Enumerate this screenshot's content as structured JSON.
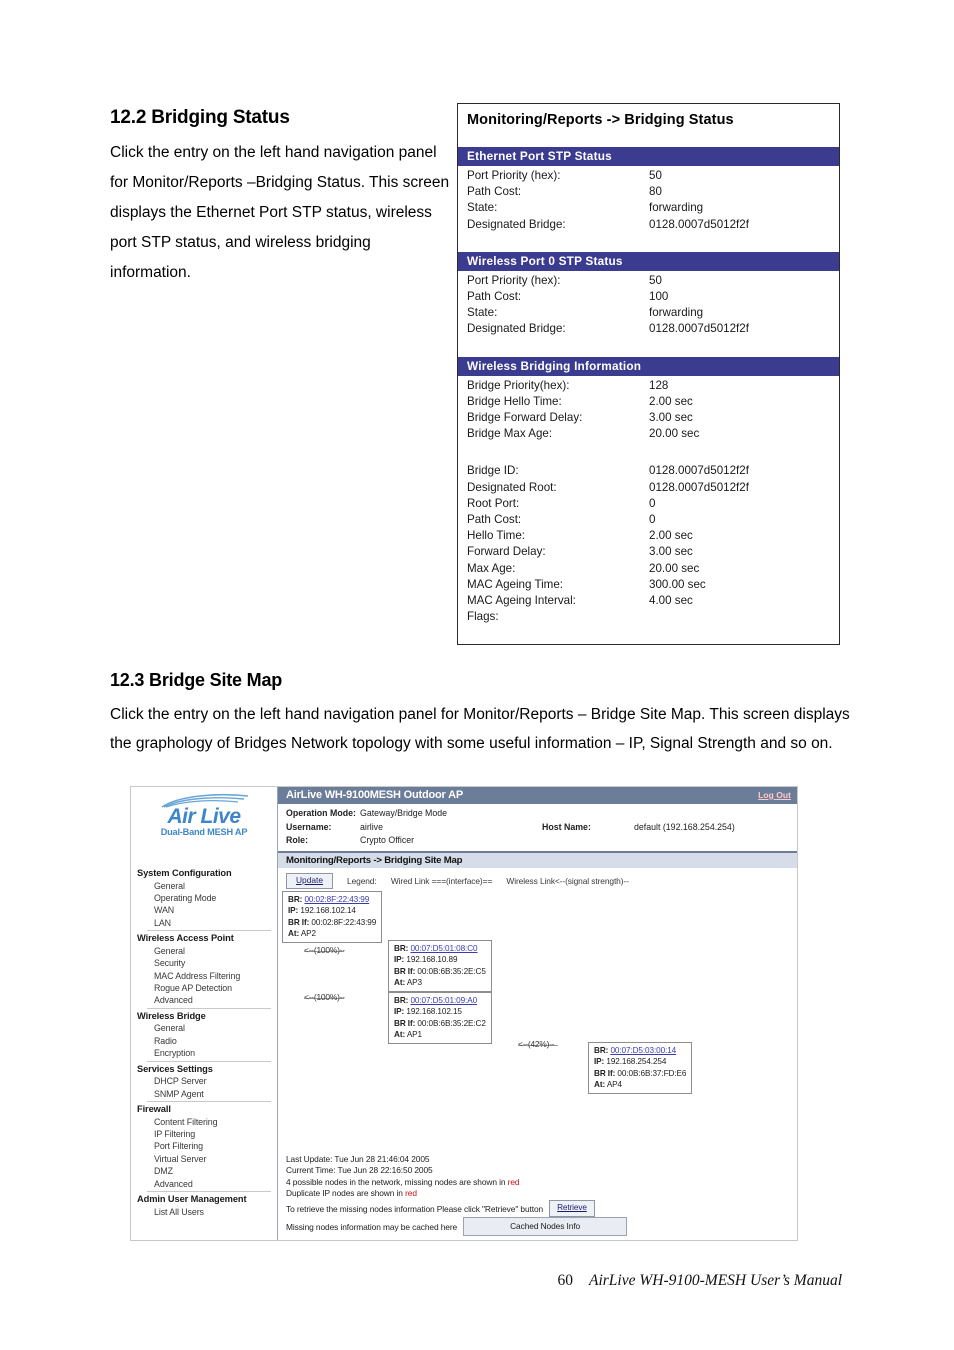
{
  "section_122": {
    "title": "12.2 Bridging Status",
    "body": "Click the entry on the left hand navigation panel for Monitor/Reports –Bridging Status. This screen displays the Ethernet Port STP status, wireless port STP status, and wireless bridging information."
  },
  "section_123": {
    "title": "12.3 Bridge Site Map",
    "body": "Click the entry on the left hand navigation panel for Monitor/Reports – Bridge Site Map. This screen displays the graphology of Bridges Network topology with some useful information – IP, Signal Strength and so on."
  },
  "bridging_status": {
    "page_title": "Monitoring/Reports -> Bridging Status",
    "sections": [
      {
        "heading": "Ethernet Port STP Status",
        "rows": [
          {
            "key": "Port Priority (hex):",
            "value": "50"
          },
          {
            "key": "Path Cost:",
            "value": "80"
          },
          {
            "key": "State:",
            "value": "forwarding"
          },
          {
            "key": "Designated Bridge:",
            "value": "0128.0007d5012f2f"
          }
        ]
      },
      {
        "heading": "Wireless Port 0 STP Status",
        "rows": [
          {
            "key": "Port Priority (hex):",
            "value": "50"
          },
          {
            "key": "Path Cost:",
            "value": "100"
          },
          {
            "key": "State:",
            "value": "forwarding"
          },
          {
            "key": "Designated Bridge:",
            "value": "0128.0007d5012f2f"
          }
        ]
      },
      {
        "heading": "Wireless Bridging Information",
        "rows": [
          {
            "key": "Bridge Priority(hex):",
            "value": "128"
          },
          {
            "key": "Bridge Hello Time:",
            "value": "2.00 sec"
          },
          {
            "key": "Bridge Forward Delay:",
            "value": "3.00 sec"
          },
          {
            "key": "Bridge Max Age:",
            "value": "20.00 sec"
          }
        ],
        "rows2": [
          {
            "key": "Bridge ID:",
            "value": "0128.0007d5012f2f"
          },
          {
            "key": "Designated Root:",
            "value": "0128.0007d5012f2f"
          },
          {
            "key": "Root Port:",
            "value": "0"
          },
          {
            "key": "Path Cost:",
            "value": "0"
          },
          {
            "key": "Hello Time:",
            "value": "2.00 sec"
          },
          {
            "key": "Forward Delay:",
            "value": "3.00 sec"
          },
          {
            "key": "Max Age:",
            "value": "20.00 sec"
          },
          {
            "key": "MAC Ageing Time:",
            "value": "300.00 sec"
          },
          {
            "key": "MAC Ageing Interval:",
            "value": "4.00 sec"
          },
          {
            "key": "Flags:",
            "value": ""
          }
        ]
      }
    ]
  },
  "site_map": {
    "logo": {
      "brand": "Air Live",
      "tagline": "Dual-Band MESH AP"
    },
    "titlebar": {
      "title": "AirLive WH-9100MESH Outdoor AP",
      "logout": "Log Out"
    },
    "info": {
      "operation_mode_label": "Operation Mode:",
      "operation_mode_value": "Gateway/Bridge Mode",
      "username_label": "Username:",
      "username_value": "airlive",
      "host_name_label": "Host Name:",
      "host_name_value": "default (192.168.254.254)",
      "role_label": "Role:",
      "role_value": "Crypto Officer"
    },
    "breadcrumb": "Monitoring/Reports -> Bridging Site Map",
    "toolbar": {
      "update_button": "Update",
      "legend_label": "Legend:",
      "legend_wired": "Wired Link ===(interface)==",
      "legend_wireless": "Wireless Link<--(signal strength)--"
    },
    "nav": [
      {
        "group": "System Configuration",
        "items": [
          "General",
          "Operating Mode",
          "WAN",
          "LAN"
        ]
      },
      {
        "group": "Wireless Access Point",
        "items": [
          "General",
          "Security",
          "MAC Address Filtering",
          "Rogue AP Detection",
          "Advanced"
        ]
      },
      {
        "group": "Wireless Bridge",
        "items": [
          "General",
          "Radio",
          "Encryption"
        ]
      },
      {
        "group": "Services Settings",
        "items": [
          "DHCP Server",
          "SNMP Agent"
        ]
      },
      {
        "group": "Firewall",
        "items": [
          "Content Filtering",
          "IP Filtering",
          "Port Filtering",
          "Virtual Server",
          "DMZ",
          "Advanced"
        ]
      },
      {
        "group": "Admin User Management",
        "items": [
          "List All Users"
        ]
      }
    ],
    "nodes": [
      {
        "br_label": "BR:",
        "br_mac": "00:02:8F:22:43:99",
        "ip_label": "IP:",
        "ip_value": "192.168.102.14",
        "brif_label": "BR If:",
        "brif_value": "00:02:8F:22:43:99",
        "at_label": "At:",
        "at_value": "AP2"
      },
      {
        "br_label": "BR:",
        "br_mac": "00:07:D5:01:08:C0",
        "ip_label": "IP:",
        "ip_value": "192.168.10.89",
        "brif_label": "BR If:",
        "brif_value": "00:0B:6B:35:2E:C5",
        "at_label": "At:",
        "at_value": "AP3"
      },
      {
        "br_label": "BR:",
        "br_mac": "00:07:D5:01:09:A0",
        "ip_label": "IP:",
        "ip_value": "192.168.102.15",
        "brif_label": "BR If:",
        "brif_value": "00:0B:6B:35:2E:C2",
        "at_label": "At:",
        "at_value": "AP1"
      },
      {
        "br_label": "BR:",
        "br_mac": "00:07:D5:03:00:14",
        "ip_label": "IP:",
        "ip_value": "192.168.254.254",
        "brif_label": "BR If:",
        "brif_value": "00:0B:6B:37:FD:E6",
        "at_label": "At:",
        "at_value": "AP4"
      }
    ],
    "edges": [
      {
        "label": "<--(100%)--"
      },
      {
        "label": "<--(100%)--"
      },
      {
        "label": "<--(42%)--"
      }
    ],
    "footer": {
      "last_update": "Last Update: Tue Jun 28 21:46:04 2005",
      "current_time": "Current Time: Tue Jun 28 22:16:50 2005",
      "possible_nodes_pre": "4 possible nodes in the network, missing nodes are shown in ",
      "possible_nodes_red": "red",
      "duplicate_pre": "Duplicate IP nodes are shown in ",
      "duplicate_red": "red",
      "retrieve_text": "To retrieve the missing nodes information Please click \"Retrieve\" button",
      "retrieve_button": "Retrieve",
      "cached_text": "Missing nodes information may be cached here",
      "cached_button": "Cached Nodes Info"
    }
  },
  "page_footer": {
    "page_number": "60",
    "manual_title": "AirLive WH-9100-MESH User’s Manual"
  },
  "colors": {
    "section_bar": "#3b3b8f",
    "titlebar": "#6b7d99",
    "breadcrumb": "#d6dde8",
    "logo_blue": "#3f86c8",
    "link_blue": "#3b3bb0",
    "alert_red": "#d01010"
  }
}
